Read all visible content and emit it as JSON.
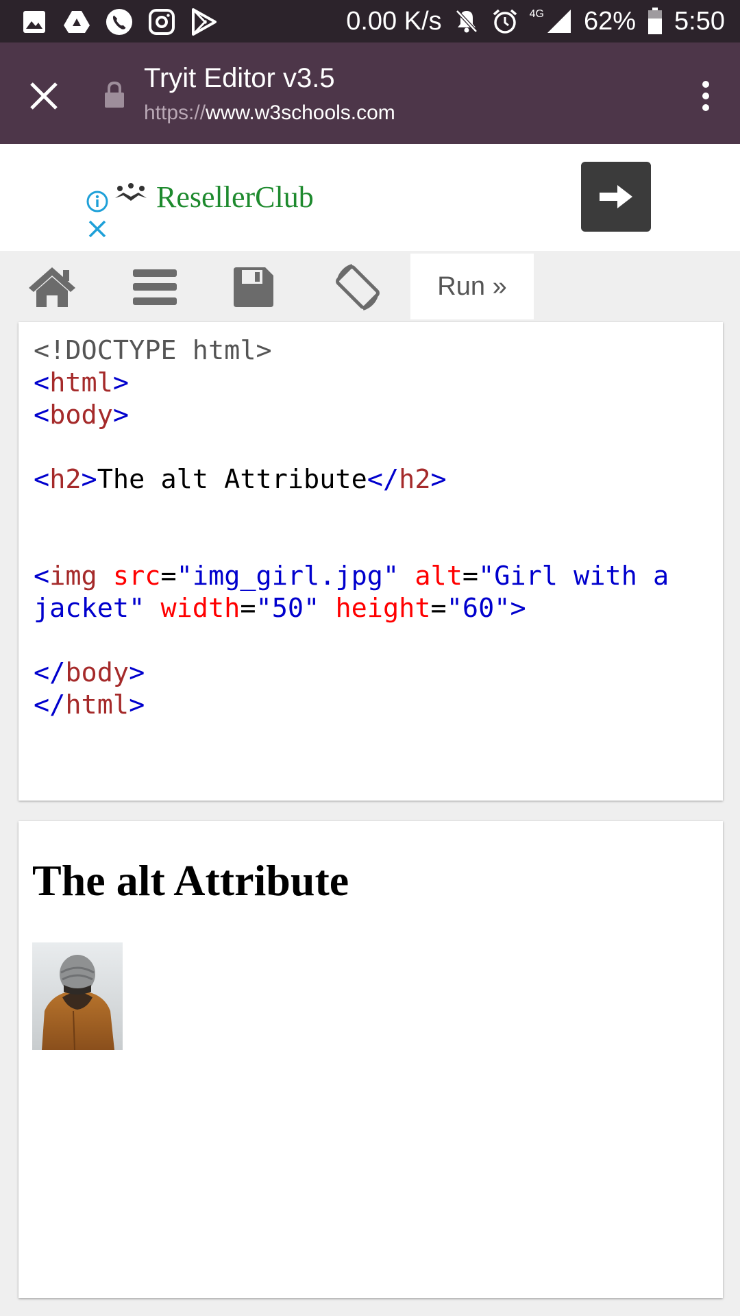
{
  "status_bar": {
    "net_speed": "0.00 K/s",
    "network": "4G",
    "battery": "62%",
    "time": "5:50"
  },
  "header": {
    "title": "Tryit Editor v3.5",
    "url_scheme": "https://",
    "url_host": "www.w3schools.com"
  },
  "ad": {
    "brand": "ResellerClub",
    "brand_color": "#1e8a2e"
  },
  "toolbar": {
    "run_label": "Run »"
  },
  "code": {
    "doctype": "<!DOCTYPE html>",
    "html_open_lt": "<",
    "html_open_tag": "html",
    "html_open_gt": ">",
    "body_open_lt": "<",
    "body_open_tag": "body",
    "body_open_gt": ">",
    "h2_open_lt": "<",
    "h2_open_tag": "h2",
    "h2_open_gt": ">",
    "h2_text": "The alt Attribute",
    "h2_close_lt": "</",
    "h2_close_tag": "h2",
    "h2_close_gt": ">",
    "img_lt": "<",
    "img_tag": "img",
    "attr_src": "src",
    "eq": "=",
    "val_src": "\"img_girl.jpg\"",
    "attr_alt": "alt",
    "val_alt_1": "\"Girl with a",
    "val_alt_2": "jacket\"",
    "attr_width": "width",
    "val_width": "\"50\"",
    "attr_height": "height",
    "val_height": "\"60\"",
    "img_gt": ">",
    "body_close_lt": "</",
    "body_close_tag": "body",
    "body_close_gt": ">",
    "html_close_lt": "</",
    "html_close_tag": "html",
    "html_close_gt": ">"
  },
  "result": {
    "heading": "The alt Attribute"
  },
  "colors": {
    "status_bar": "#2c232b",
    "header": "#4d3649",
    "tag": "#a52a2a",
    "bracket": "#0000cd",
    "attribute": "#ff0000"
  }
}
